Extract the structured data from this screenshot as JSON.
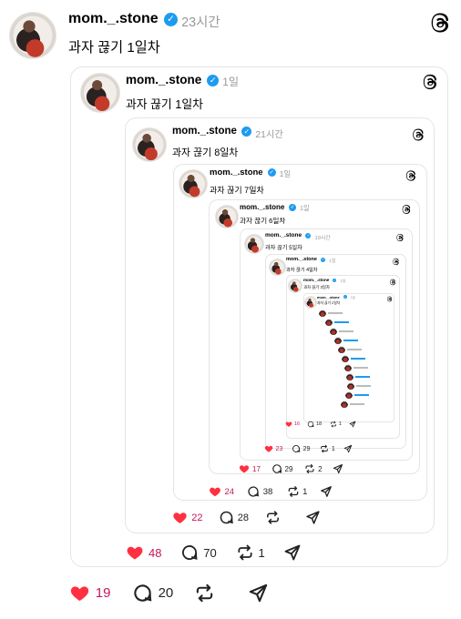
{
  "posts": [
    {
      "handle": "mom._.stone",
      "time": "23시간",
      "text": "과자 끊기 1일차",
      "likes": "19",
      "comments": "20",
      "reposts": "",
      "like_color": "#ff3040"
    },
    {
      "handle": "mom._.stone",
      "time": "1일",
      "text": "과자 끊기 1일차",
      "likes": "48",
      "comments": "70",
      "reposts": "1"
    },
    {
      "handle": "mom._.stone",
      "time": "21시간",
      "text": "과자 끊기 8일차",
      "likes": "22",
      "comments": "28",
      "reposts": ""
    },
    {
      "handle": "mom._.stone",
      "time": "1일",
      "text": "과자 끊기 7일차",
      "likes": "24",
      "comments": "38",
      "reposts": "1"
    },
    {
      "handle": "mom._.stone",
      "time": "1일",
      "text": "과자 끊기 6일차",
      "likes": "17",
      "comments": "29",
      "reposts": "2"
    },
    {
      "handle": "mom._.stone",
      "time": "19시간",
      "text": "과자 끊기 5일차",
      "likes": "23",
      "comments": "29",
      "reposts": "1"
    },
    {
      "handle": "mom._.stone",
      "time": "1일",
      "text": "과자 끊기 4일차",
      "likes": "16",
      "comments": "18",
      "reposts": "1"
    },
    {
      "handle": "mom._.stone",
      "time": "1일",
      "text": "과자 끊기 3일차",
      "likes": "",
      "comments": "",
      "reposts": ""
    },
    {
      "handle": "mom._.stone",
      "time": "1일",
      "text": "과자 끊기 2일차",
      "likes": "",
      "comments": "",
      "reposts": ""
    }
  ],
  "icons": {
    "threads": "threads-logo-icon",
    "like": "heart-icon",
    "comment": "comment-icon",
    "repost": "repost-icon",
    "share": "share-icon",
    "verified": "verified-badge-icon"
  }
}
